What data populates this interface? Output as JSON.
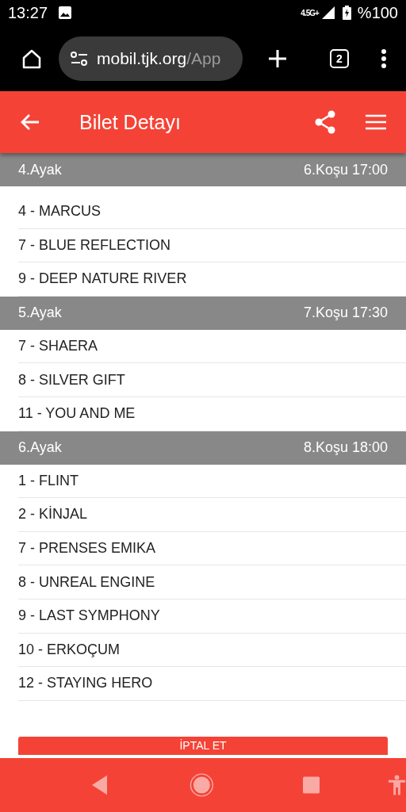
{
  "status_bar": {
    "time": "13:27",
    "network": "4.5G+",
    "battery": "%100"
  },
  "browser": {
    "url_host": "mobil.tjk.org",
    "url_path": "/App",
    "tab_count": "2"
  },
  "header": {
    "title": "Bilet Detayı"
  },
  "legs": [
    {
      "leg": "4.Ayak",
      "race": "6.Koşu 17:00",
      "horses": [
        "4 - MARCUS",
        "7 - BLUE REFLECTION",
        "9 - DEEP NATURE RIVER"
      ]
    },
    {
      "leg": "5.Ayak",
      "race": "7.Koşu 17:30",
      "horses": [
        "7 - SHAERA",
        "8 - SILVER GIFT",
        "11 - YOU AND ME"
      ]
    },
    {
      "leg": "6.Ayak",
      "race": "8.Koşu 18:00",
      "horses": [
        "1 - FLINT",
        "2 - KİNJAL",
        "7 - PRENSES EMIKA",
        "8 - UNREAL ENGINE",
        "9 - LAST SYMPHONY",
        "10 - ERKOÇUM",
        "12 - STAYING HERO"
      ]
    }
  ],
  "cancel_button": "İPTAL ET"
}
